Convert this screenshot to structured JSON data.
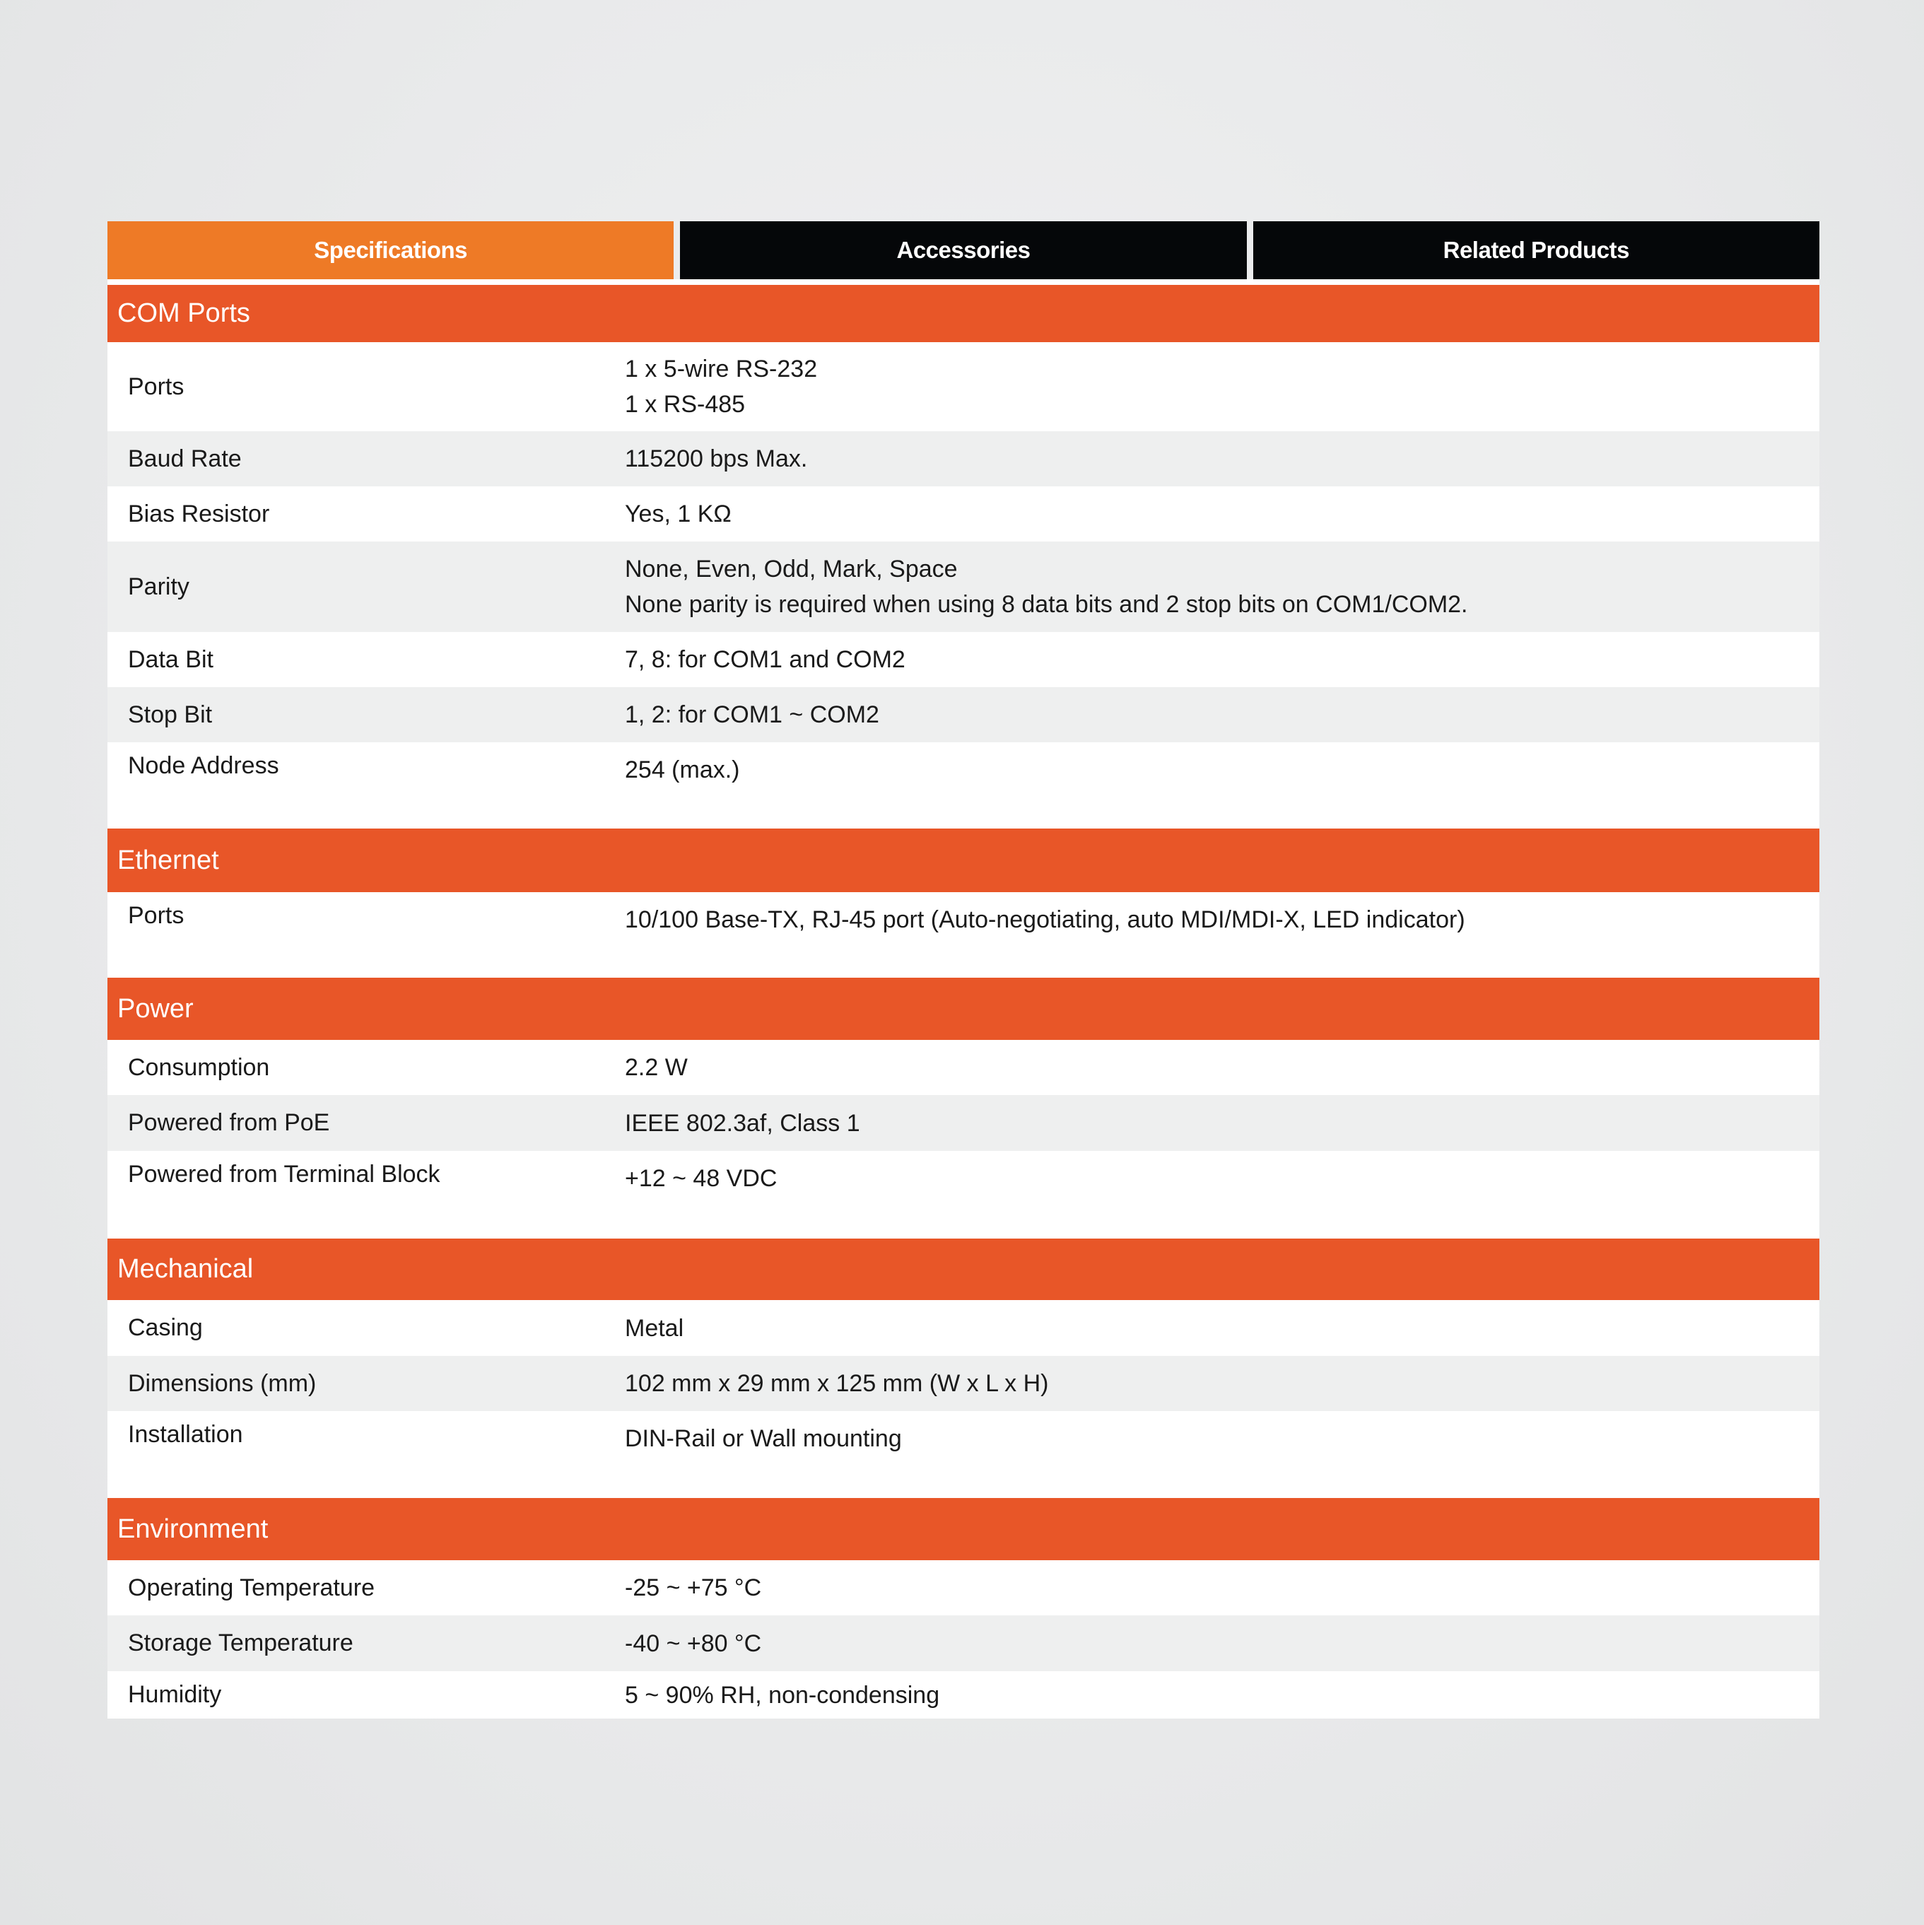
{
  "tabs": [
    {
      "label": "Specifications",
      "active": true
    },
    {
      "label": "Accessories",
      "active": false
    },
    {
      "label": "Related Products",
      "active": false
    }
  ],
  "colors": {
    "active_tab": "#ee7a26",
    "inactive_tab": "#050709",
    "section_header": "#e85628",
    "alt_row": "#eeefef"
  },
  "sections": [
    {
      "title": "COM Ports",
      "rows": [
        {
          "label": "Ports",
          "value_lines": [
            "1 x 5-wire RS-232",
            "1 x RS-485"
          ]
        },
        {
          "label": "Baud Rate",
          "value": "115200 bps Max."
        },
        {
          "label": "Bias Resistor",
          "value": "Yes, 1 KΩ"
        },
        {
          "label": "Parity",
          "value_lines": [
            "None, Even, Odd, Mark, Space",
            "None parity is required when using 8 data bits and 2 stop bits on COM1/COM2."
          ]
        },
        {
          "label": "Data Bit",
          "value": "7, 8: for COM1 and COM2"
        },
        {
          "label": "Stop Bit",
          "value": "1, 2: for COM1 ~ COM2"
        },
        {
          "label": "Node Address",
          "value": "254 (max.)"
        }
      ]
    },
    {
      "title": "Ethernet",
      "rows": [
        {
          "label": "Ports",
          "value": "10/100 Base-TX, RJ-45 port (Auto-negotiating, auto MDI/MDI-X, LED indicator)"
        }
      ]
    },
    {
      "title": "Power",
      "rows": [
        {
          "label": "Consumption",
          "value": "2.2 W"
        },
        {
          "label": "Powered from PoE",
          "value": "IEEE 802.3af, Class 1"
        },
        {
          "label": "Powered from Terminal Block",
          "value": "+12 ~ 48 VDC"
        }
      ]
    },
    {
      "title": "Mechanical",
      "rows": [
        {
          "label": "Casing",
          "value": "Metal"
        },
        {
          "label": "Dimensions (mm)",
          "value": "102 mm x 29 mm x 125 mm (W x L x H)"
        },
        {
          "label": "Installation",
          "value": "DIN-Rail or Wall mounting"
        }
      ]
    },
    {
      "title": "Environment",
      "rows": [
        {
          "label": "Operating Temperature",
          "value": "-25 ~ +75 °C"
        },
        {
          "label": "Storage Temperature",
          "value": "-40 ~ +80 °C"
        },
        {
          "label": "Humidity",
          "value": "5 ~ 90% RH, non-condensing"
        }
      ]
    }
  ]
}
